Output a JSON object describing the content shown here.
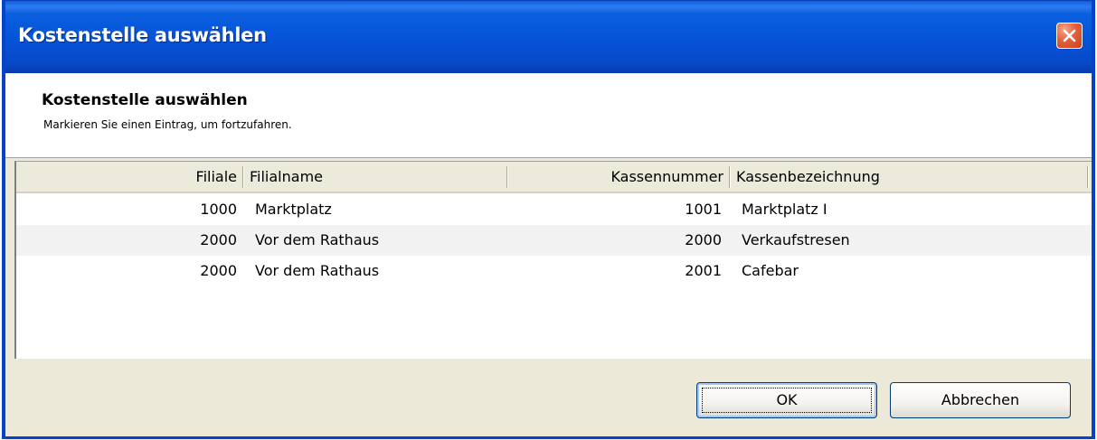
{
  "window": {
    "title": "Kostenstelle auswählen"
  },
  "header": {
    "title": "Kostenstelle auswählen",
    "subtitle": "Markieren Sie einen Eintrag, um fortzufahren."
  },
  "table": {
    "columns": [
      "Filiale",
      "Filialname",
      "Kassennummer",
      "Kassenbezeichnung"
    ],
    "rows": [
      [
        "1000",
        "Marktplatz",
        "1001",
        "Marktplatz I"
      ],
      [
        "2000",
        "Vor dem Rathaus",
        "2000",
        "Verkaufstresen"
      ],
      [
        "2000",
        "Vor dem Rathaus",
        "2001",
        "Cafebar"
      ]
    ]
  },
  "buttons": {
    "ok": "OK",
    "cancel": "Abbrechen"
  },
  "icons": {
    "close": "close-icon"
  },
  "colors": {
    "titlebar": "#0a5fe0",
    "close_button": "#e5603a",
    "dialog_face": "#ece9d8",
    "row_alt": "#f2f2f2"
  }
}
